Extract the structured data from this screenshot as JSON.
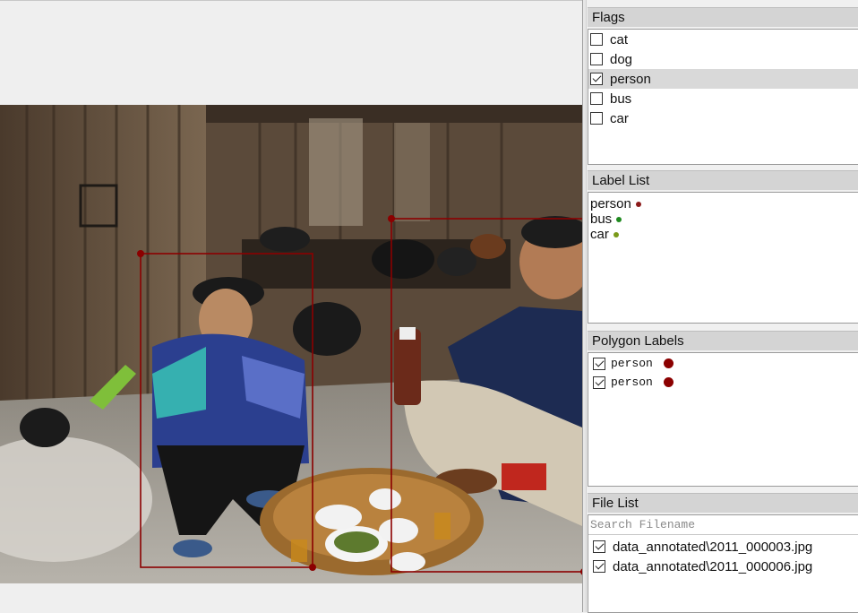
{
  "panels": {
    "flags": {
      "title": "Flags",
      "items": [
        {
          "label": "cat",
          "checked": false,
          "selected": false
        },
        {
          "label": "dog",
          "checked": false,
          "selected": false
        },
        {
          "label": "person",
          "checked": true,
          "selected": true
        },
        {
          "label": "bus",
          "checked": false,
          "selected": false
        },
        {
          "label": "car",
          "checked": false,
          "selected": false
        }
      ]
    },
    "label_list": {
      "title": "Label List",
      "items": [
        {
          "label": "person",
          "color": "#8b1a1a"
        },
        {
          "label": "bus",
          "color": "#1f8a1f"
        },
        {
          "label": "car",
          "color": "#7a9a1a"
        }
      ]
    },
    "polygon_labels": {
      "title": "Polygon Labels",
      "items": [
        {
          "label": "person",
          "checked": true,
          "color": "#8b0000"
        },
        {
          "label": "person",
          "checked": true,
          "color": "#8b0000"
        }
      ]
    },
    "file_list": {
      "title": "File List",
      "search_placeholder": "Search Filename",
      "search_value": "",
      "items": [
        {
          "label": "data_annotated\\2011_000003.jpg",
          "checked": true
        },
        {
          "label": "data_annotated\\2011_000006.jpg",
          "checked": true
        }
      ]
    }
  },
  "canvas": {
    "shape_color": "#8b0000",
    "shapes": [
      {
        "label": "person",
        "type": "rectangle"
      },
      {
        "label": "person",
        "type": "rectangle"
      }
    ]
  }
}
